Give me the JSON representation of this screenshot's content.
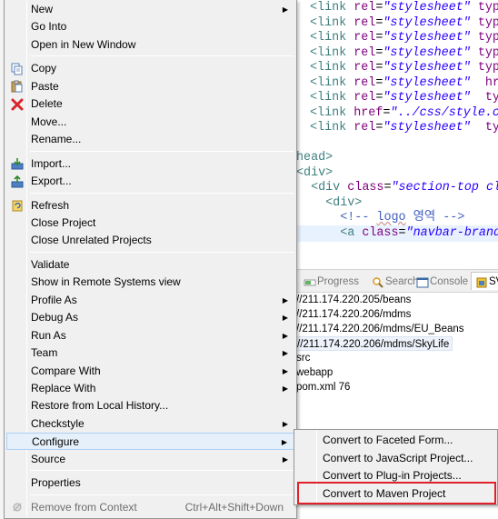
{
  "editor": {
    "lines": [
      {
        "parts": [
          [
            "tag",
            "<link "
          ],
          [
            "attr",
            "rel"
          ],
          [
            "eq",
            "="
          ],
          [
            "val",
            "\"stylesheet\""
          ],
          [
            "eq",
            " "
          ],
          [
            "attr",
            "type"
          ]
        ]
      },
      {
        "parts": [
          [
            "tag",
            "<link "
          ],
          [
            "attr",
            "rel"
          ],
          [
            "eq",
            "="
          ],
          [
            "val",
            "\"stylesheet\""
          ],
          [
            "eq",
            " "
          ],
          [
            "attr",
            "type"
          ]
        ]
      },
      {
        "parts": [
          [
            "tag",
            "<link "
          ],
          [
            "attr",
            "rel"
          ],
          [
            "eq",
            "="
          ],
          [
            "val",
            "\"stylesheet\""
          ],
          [
            "eq",
            " "
          ],
          [
            "attr",
            "type"
          ]
        ]
      },
      {
        "parts": [
          [
            "tag",
            "<link "
          ],
          [
            "attr",
            "rel"
          ],
          [
            "eq",
            "="
          ],
          [
            "val",
            "\"stylesheet\""
          ],
          [
            "eq",
            " "
          ],
          [
            "attr",
            "type"
          ]
        ]
      },
      {
        "parts": [
          [
            "tag",
            "<link "
          ],
          [
            "attr",
            "rel"
          ],
          [
            "eq",
            "="
          ],
          [
            "val",
            "\"stylesheet\""
          ],
          [
            "eq",
            " "
          ],
          [
            "attr",
            "type"
          ]
        ]
      },
      {
        "parts": [
          [
            "tag",
            "<link "
          ],
          [
            "attr",
            "rel"
          ],
          [
            "eq",
            "="
          ],
          [
            "val",
            "\"stylesheet\""
          ],
          [
            "eq",
            "  "
          ],
          [
            "attr",
            "hre"
          ]
        ]
      },
      {
        "parts": [
          [
            "tag",
            "<link "
          ],
          [
            "attr",
            "rel"
          ],
          [
            "eq",
            "="
          ],
          [
            "val",
            "\"stylesheet\""
          ],
          [
            "eq",
            "  "
          ],
          [
            "attr",
            "typ"
          ]
        ]
      },
      {
        "parts": [
          [
            "tag",
            "<link "
          ],
          [
            "attr",
            "href"
          ],
          [
            "eq",
            "="
          ],
          [
            "val",
            "\"../css/style.c"
          ]
        ]
      },
      {
        "parts": [
          [
            "tag",
            "<link "
          ],
          [
            "attr",
            "rel"
          ],
          [
            "eq",
            "="
          ],
          [
            "val",
            "\"stylesheet\""
          ],
          [
            "eq",
            "  "
          ],
          [
            "attr",
            "typ"
          ]
        ]
      },
      {
        "parts": []
      },
      {
        "parts": [
          [
            "tag",
            "head>"
          ]
        ]
      },
      {
        "parts": [
          [
            "tag",
            "<div>"
          ]
        ]
      },
      {
        "parts": [
          [
            "tag",
            "  <div "
          ],
          [
            "attr",
            "class"
          ],
          [
            "eq",
            "="
          ],
          [
            "val",
            "\"section-top cl"
          ]
        ]
      },
      {
        "parts": [
          [
            "tag",
            "    <div>"
          ]
        ]
      },
      {
        "parts": [
          [
            "cmt",
            "      <!-- "
          ],
          [
            "cmt-ko",
            "logo"
          ],
          [
            "cmt",
            " 영역 -->"
          ]
        ]
      },
      {
        "parts": [
          [
            "tag",
            "      <a "
          ],
          [
            "attr",
            "class"
          ],
          [
            "eq",
            "="
          ],
          [
            "val",
            "\"navbar-brand"
          ]
        ]
      }
    ]
  },
  "view_tabs": [
    {
      "label": "Progress",
      "icon": "progress-icon",
      "active": false
    },
    {
      "label": "Search",
      "icon": "search-icon",
      "active": false
    },
    {
      "label": "Console",
      "icon": "console-icon",
      "active": false
    },
    {
      "label": "SV",
      "icon": "svn-repositories-icon",
      "active": true
    }
  ],
  "repo_tree": [
    {
      "label": "//211.174.220.205/beans",
      "selected": false
    },
    {
      "label": "//211.174.220.206/mdms",
      "selected": false
    },
    {
      "label": "//211.174.220.206/mdms/EU_Beans",
      "selected": false
    },
    {
      "label": "//211.174.220.206/mdms/SkyLife",
      "selected": true
    },
    {
      "label": "src",
      "selected": false
    },
    {
      "label": "webapp",
      "selected": false
    },
    {
      "label": "pom.xml 76",
      "selected": false
    }
  ],
  "context_menu": {
    "items": [
      {
        "label": "New",
        "submenu": true
      },
      {
        "label": "Go Into"
      },
      {
        "label": "Open in New Window"
      },
      {
        "sep": true
      },
      {
        "label": "Copy",
        "icon": "copy-icon"
      },
      {
        "label": "Paste",
        "icon": "paste-icon"
      },
      {
        "label": "Delete",
        "icon": "delete-icon"
      },
      {
        "label": "Move..."
      },
      {
        "label": "Rename..."
      },
      {
        "sep": true
      },
      {
        "label": "Import...",
        "icon": "import-icon"
      },
      {
        "label": "Export...",
        "icon": "export-icon"
      },
      {
        "sep": true
      },
      {
        "label": "Refresh",
        "icon": "refresh-icon"
      },
      {
        "label": "Close Project"
      },
      {
        "label": "Close Unrelated Projects"
      },
      {
        "sep": true
      },
      {
        "label": "Validate"
      },
      {
        "label": "Show in Remote Systems view"
      },
      {
        "label": "Profile As",
        "submenu": true
      },
      {
        "label": "Debug As",
        "submenu": true
      },
      {
        "label": "Run As",
        "submenu": true
      },
      {
        "label": "Team",
        "submenu": true
      },
      {
        "label": "Compare With",
        "submenu": true
      },
      {
        "label": "Replace With",
        "submenu": true
      },
      {
        "label": "Restore from Local History..."
      },
      {
        "label": "Checkstyle",
        "submenu": true
      },
      {
        "label": "Configure",
        "submenu": true,
        "hover": true
      },
      {
        "label": "Source",
        "submenu": true
      },
      {
        "sep": true
      },
      {
        "label": "Properties"
      },
      {
        "sep": true
      },
      {
        "label": "Remove from Context",
        "icon": "remove-context-icon",
        "accelerator": "Ctrl+Alt+Shift+Down",
        "disabled": true
      }
    ]
  },
  "configure_submenu": {
    "items": [
      {
        "label": "Convert to Faceted Form..."
      },
      {
        "label": "Convert to JavaScript Project..."
      },
      {
        "label": "Convert to Plug-in Projects..."
      },
      {
        "label": "Convert to Maven Project",
        "highlighted": true
      }
    ],
    "highlight_color": "#e0202a"
  }
}
